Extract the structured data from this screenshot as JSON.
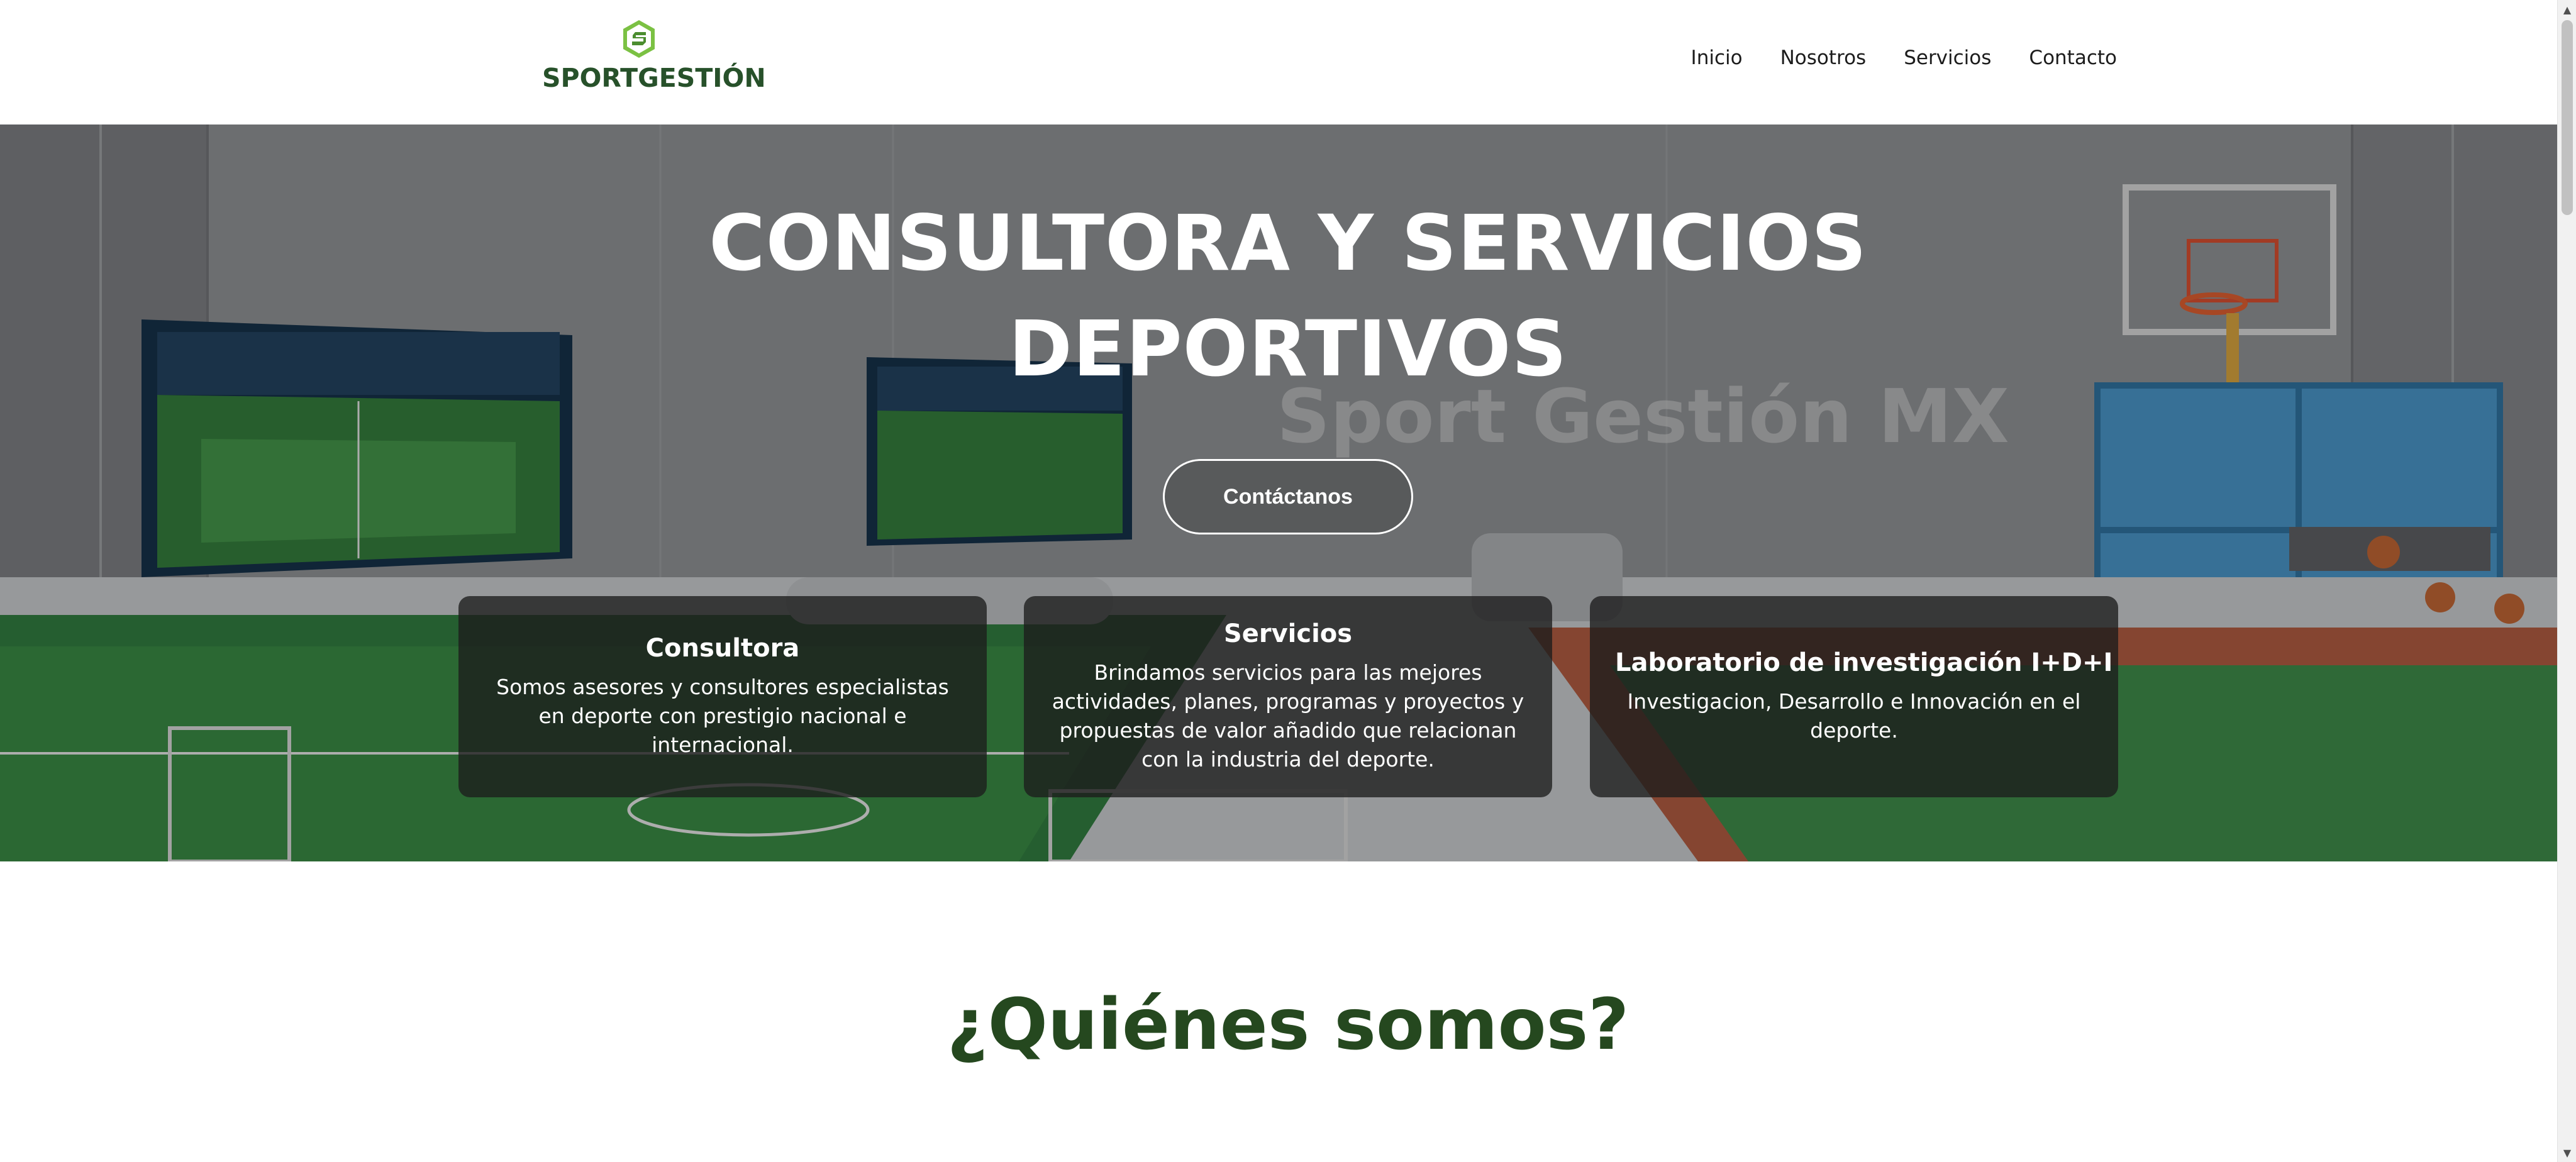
{
  "header": {
    "logo_text": "SPORTGESTIÓN",
    "nav": [
      "Inicio",
      "Nosotros",
      "Servicios",
      "Contacto"
    ]
  },
  "hero": {
    "title_line1": "CONSULTORA Y SERVICIOS",
    "title_line2": "DEPORTIVOS",
    "cta_label": "Contáctanos",
    "watermark": "Sport Gestión MX",
    "cards": [
      {
        "title": "Consultora",
        "text": "Somos asesores y consultores especialistas en deporte con prestigio nacional e internacional."
      },
      {
        "title": "Servicios",
        "text": "Brindamos servicios para las mejores actividades, planes, programas y proyectos y propuestas de valor añadido que relacionan con la industria del deporte."
      },
      {
        "title": "Laboratorio de investigación I+D+I",
        "text": "Investigacion, Desarrollo e Innovación en el deporte."
      }
    ]
  },
  "about": {
    "title": "¿Quiénes somos?"
  },
  "colors": {
    "brand_green": "#27512a",
    "logo_accent": "#7bc143",
    "heading_green": "#25481f"
  },
  "icons": {
    "logo": "s-hexagon-logo-icon",
    "scroll_up": "scroll-up-arrow-icon",
    "scroll_down": "scroll-down-arrow-icon"
  }
}
